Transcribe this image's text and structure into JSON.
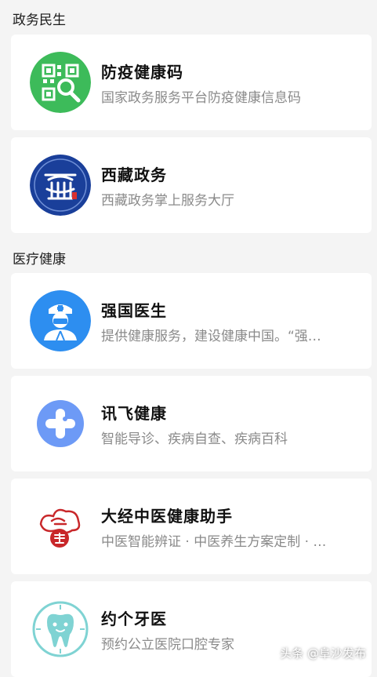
{
  "sections": [
    {
      "title": "政务民生"
    },
    {
      "title": "医疗健康"
    }
  ],
  "apps": [
    {
      "name": "防疫健康码",
      "desc": "国家政务服务平台防疫健康信息码",
      "icon": "qr-code-icon",
      "color": "#3dbb5a"
    },
    {
      "name": "西藏政务",
      "desc": "西藏政务掌上服务大厅",
      "icon": "tibet-emblem-icon",
      "color": "#1a3f9a"
    },
    {
      "name": "强国医生",
      "desc": "提供健康服务，建设健康中国。“强…",
      "icon": "doctor-icon",
      "color": "#2d8ef0"
    },
    {
      "name": "讯飞健康",
      "desc": "智能导诊、疾病自查、疾病百科",
      "icon": "cross-chat-icon",
      "color": "#5b8ff5"
    },
    {
      "name": "大经中医健康助手",
      "desc": "中医智能辨证 · 中医养生方案定制 · …",
      "icon": "tcm-seal-icon",
      "color": "#c8272a"
    },
    {
      "name": "约个牙医",
      "desc": "预约公立医院口腔专家",
      "icon": "tooth-icon",
      "color": "#7fd3d3"
    }
  ],
  "watermark": "头条 @阜沙发布"
}
